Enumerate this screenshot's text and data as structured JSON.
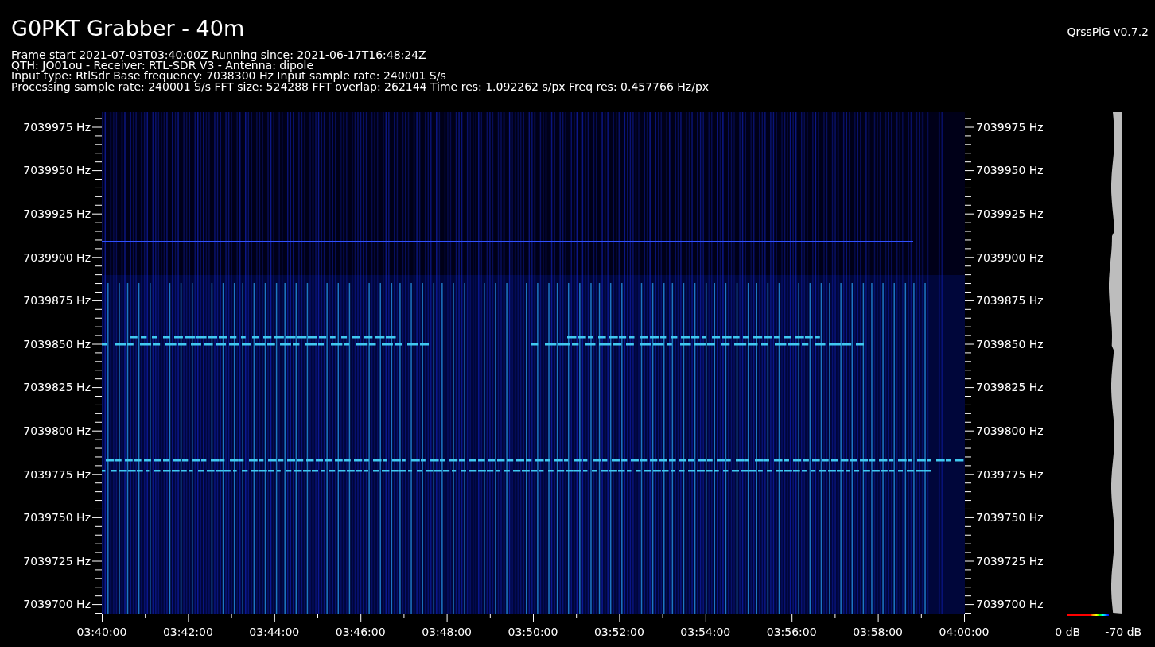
{
  "title": "G0PKT Grabber - 40m",
  "version": "QrssPiG v0.7.2",
  "info_lines": [
    "Frame start 2021-07-03T03:40:00Z Running since: 2021-06-17T16:48:24Z",
    "QTH: JO01ou - Receiver: RTL-SDR V3 - Antenna: dipole",
    "Input type: RtlSdr Base frequency: 7038300 Hz Input sample rate: 240001 S/s",
    "Processing sample rate: 240001 S/s FFT size: 524288 FFT overlap: 262144 Time res: 1.092262 s/px Freq res: 0.457766 Hz/px"
  ],
  "left_frequency_labels": [
    "7039975 Hz",
    "7039950 Hz",
    "7039925 Hz",
    "7039900 Hz",
    "7039875 Hz",
    "7039850 Hz",
    "7039825 Hz",
    "7039800 Hz",
    "7039775 Hz",
    "7039750 Hz",
    "7039725 Hz",
    "7039700 Hz"
  ],
  "right_frequency_labels": [
    "7039975 Hz",
    "7039950 Hz",
    "7039925 Hz",
    "7039900 Hz",
    "7039875 Hz",
    "7039850 Hz",
    "7039825 Hz",
    "7039800 Hz",
    "7039775 Hz",
    "7039750 Hz",
    "7039725 Hz",
    "7039700 Hz"
  ],
  "time_labels": [
    "03:40:00",
    "03:42:00",
    "03:44:00",
    "03:46:00",
    "03:48:00",
    "03:50:00",
    "03:52:00",
    "03:54:00",
    "03:56:00",
    "03:58:00",
    "04:00:00"
  ],
  "scale_labels": [
    "0 dB",
    "-70 dB"
  ]
}
